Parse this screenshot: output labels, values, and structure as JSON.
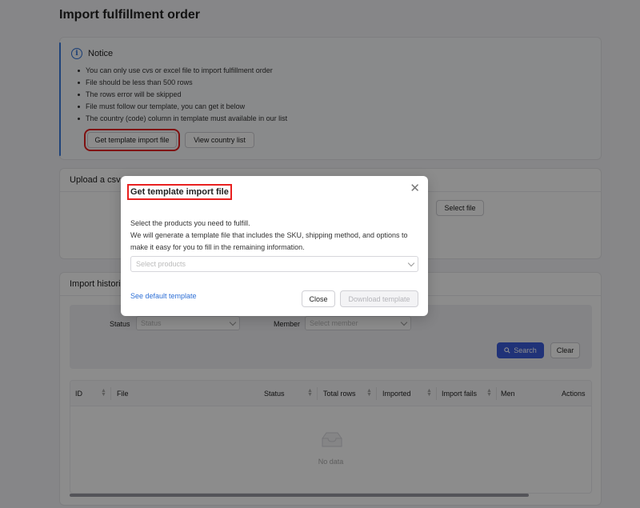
{
  "page": {
    "title": "Import fulfillment order"
  },
  "notice": {
    "title": "Notice",
    "items": [
      "You can only use cvs or excel file to import fulfillment order",
      "File should be less than 500 rows",
      "The rows error will be skipped",
      "File must follow our template, you can get it below",
      "The country (code) column in template must available in our list"
    ],
    "get_template_label": "Get template import file",
    "view_country_label": "View country list"
  },
  "upload": {
    "title": "Upload a csv",
    "select_file_label": "Select file"
  },
  "history": {
    "title": "Import histori",
    "filters": {
      "status_label": "Status",
      "status_placeholder": "Status",
      "member_label": "Member",
      "member_placeholder": "Select member",
      "search_label": "Search",
      "clear_label": "Clear"
    },
    "columns": [
      "ID",
      "File",
      "Status",
      "Total rows",
      "Imported",
      "Import fails",
      "Men",
      "Actions"
    ],
    "empty_text": "No data"
  },
  "modal": {
    "title": "Get template import file",
    "description_line1": "Select the products you need to fulfill.",
    "description_line2": "We will generate a template file that includes the SKU, shipping method, and options to make it easy for you to fill in the remaining information.",
    "select_placeholder": "Select products",
    "default_template_link": "See default template",
    "close_label": "Close",
    "download_label": "Download template"
  },
  "colors": {
    "accent": "#3b5bdb",
    "link": "#2d6fd6",
    "highlight": "#e8201f"
  }
}
